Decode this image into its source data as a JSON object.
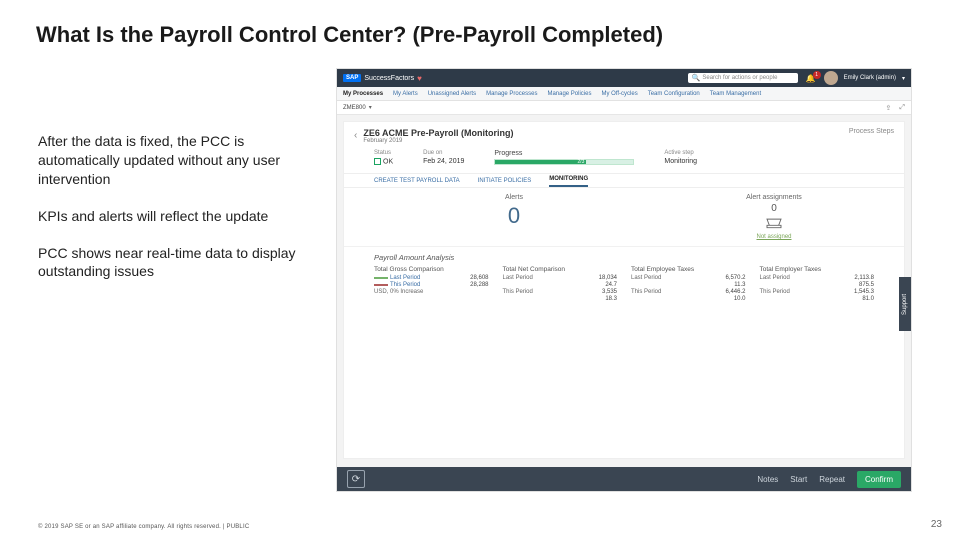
{
  "slide": {
    "title": "What Is the Payroll Control Center? (Pre-Payroll Completed)",
    "paragraphs": [
      "After the data is fixed, the PCC is automatically updated without any user intervention",
      "KPIs and alerts will reflect the update",
      "PCC shows near real-time data to display outstanding issues"
    ],
    "footer": "© 2019 SAP SE or an SAP affiliate company. All rights reserved.   |   PUBLIC",
    "page_number": "23"
  },
  "screenshot": {
    "brand": {
      "sap": "SAP",
      "product": "SuccessFactors"
    },
    "search_placeholder": "Search for actions or people",
    "notification_count": "1",
    "user_name": "Emily Clark (admin)",
    "nav_items": [
      "My Processes",
      "My Alerts",
      "Unassigned Alerts",
      "Manage Processes",
      "Manage Policies",
      "My Off-cycles",
      "Team Configuration",
      "Team Management"
    ],
    "nav_active_index": 0,
    "payroll_area": "ZME800",
    "process_title": "ZE6 ACME Pre-Payroll (Monitoring)",
    "process_subtitle": "February 2019",
    "process_steps_label": "Process Steps",
    "metrics": {
      "status_label": "Status",
      "status_value": "OK",
      "due_label": "Due on",
      "due_value": "Feb 24, 2019",
      "progress_label": "Progress",
      "progress_value": "2/3",
      "active_step_label": "Active step",
      "active_step_value": "Monitoring"
    },
    "tabs": [
      "CREATE TEST PAYROLL DATA",
      "INITIATE POLICIES",
      "MONITORING"
    ],
    "tab_active_index": 2,
    "monitoring": {
      "alerts_label": "Alerts",
      "alerts_value": "0",
      "assignments_label": "Alert assignments",
      "assignments_value": "0",
      "not_assigned": "Not assigned"
    },
    "analysis": {
      "heading": "Payroll Amount Analysis",
      "columns": [
        {
          "label": "Total Gross Comparison",
          "rows": [
            {
              "name": "Last Period",
              "value": "28,608",
              "swatch": "sw-green",
              "link": true
            },
            {
              "name": "This Period",
              "value": "28,288",
              "swatch": "sw-red",
              "link": true
            }
          ],
          "foot": "USD, 0% Increase"
        },
        {
          "label": "Total Net Comparison",
          "rows": [
            {
              "name": "Last Period",
              "value": "18,034"
            },
            {
              "name": "",
              "value": "24.7"
            },
            {
              "name": "This Period",
              "value": "3,535"
            },
            {
              "name": "",
              "value": "18.3"
            }
          ]
        },
        {
          "label": "Total Employee Taxes",
          "rows": [
            {
              "name": "Last Period",
              "value": "6,570.2"
            },
            {
              "name": "",
              "value": "11.3"
            },
            {
              "name": "This Period",
              "value": "6,446.2"
            },
            {
              "name": "",
              "value": "10.0"
            }
          ]
        },
        {
          "label": "Total Employer Taxes",
          "rows": [
            {
              "name": "Last Period",
              "value": "2,113.8"
            },
            {
              "name": "",
              "value": "875.5"
            },
            {
              "name": "This Period",
              "value": "1,545.3"
            },
            {
              "name": "",
              "value": "81.0"
            }
          ]
        }
      ]
    },
    "bottom_bar": {
      "links": [
        "Notes",
        "Start",
        "Repeat"
      ],
      "confirm": "Confirm"
    },
    "support_tab": "Support"
  }
}
